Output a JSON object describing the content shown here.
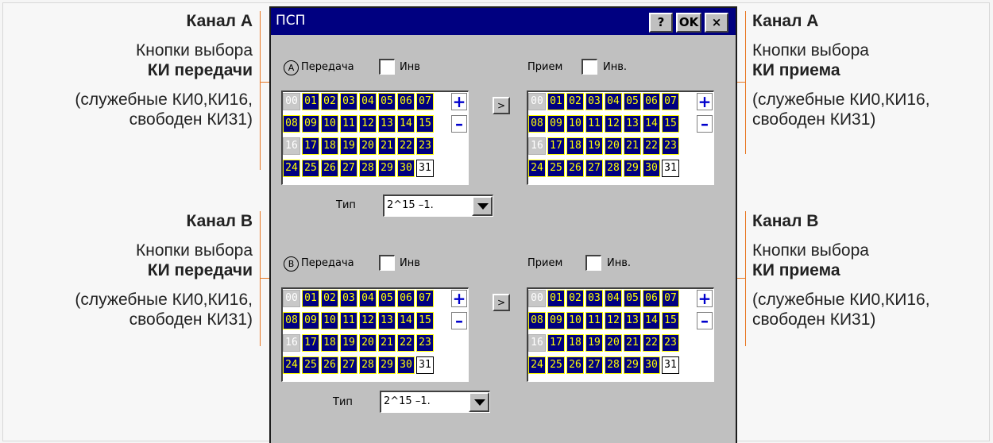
{
  "annotations": {
    "a_left": {
      "title": "Канал А",
      "line1": "Кнопки выбора",
      "line2": "КИ передачи",
      "line3": "(служебные КИ0,КИ16,",
      "line4": "свободен КИ31)"
    },
    "b_left": {
      "title": "Канал В",
      "line1": "Кнопки выбора",
      "line2": "КИ передачи",
      "line3": "(служебные КИ0,КИ16,",
      "line4": "свободен КИ31)"
    },
    "a_right": {
      "title": "Канал А",
      "line1": "Кнопки выбора",
      "line2": "КИ приема",
      "line3": "(служебные КИ0,КИ16,",
      "line4": "свободен КИ31)"
    },
    "b_right": {
      "title": "Канал В",
      "line1": "Кнопки выбора",
      "line2": "КИ приема",
      "line3": "(служебные КИ0,КИ16,",
      "line4": "свободен КИ31)"
    }
  },
  "dialog": {
    "title": "ПСП",
    "help_label": "?",
    "ok_label": "OK",
    "close_label": "×"
  },
  "channel_a": {
    "badge": "A",
    "tx_label": "Передача",
    "tx_inv_label": "Инв",
    "rx_label": "Прием",
    "rx_inv_label": "Инв.",
    "arrow_label": ">",
    "type_label": "Тип",
    "type_value": "2^15 –1."
  },
  "channel_b": {
    "badge": "B",
    "tx_label": "Передача",
    "tx_inv_label": "Инв",
    "rx_label": "Прием",
    "rx_inv_label": "Инв.",
    "arrow_label": ">",
    "type_label": "Тип",
    "type_value": "2^15 –1."
  },
  "timeslots": [
    "00",
    "01",
    "02",
    "03",
    "04",
    "05",
    "06",
    "07",
    "08",
    "09",
    "10",
    "11",
    "12",
    "13",
    "14",
    "15",
    "16",
    "17",
    "18",
    "19",
    "20",
    "21",
    "22",
    "23",
    "24",
    "25",
    "26",
    "27",
    "28",
    "29",
    "30",
    "31"
  ],
  "service_slots": [
    "00",
    "16"
  ],
  "free_slots": [
    "31"
  ],
  "plus_label": "+",
  "minus_label": "–",
  "colors": {
    "selected_bg": "#000080",
    "selected_text": "#ffff00",
    "accent_line": "#e87722",
    "titlebar": "#000080"
  }
}
